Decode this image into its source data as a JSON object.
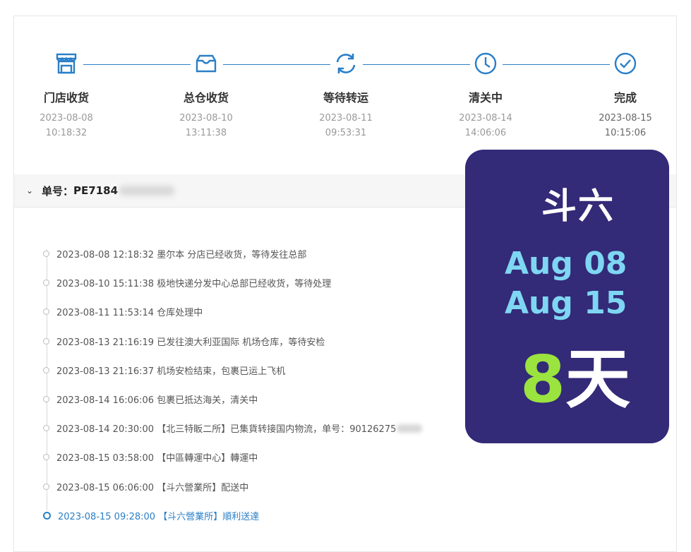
{
  "stepper": {
    "steps": [
      {
        "name": "门店收货",
        "date": "2023-08-08",
        "time": "10:18:32",
        "icon": "storefront-icon"
      },
      {
        "name": "总仓收货",
        "date": "2023-08-10",
        "time": "13:11:38",
        "icon": "warehouse-box-icon"
      },
      {
        "name": "等待转运",
        "date": "2023-08-11",
        "time": "09:53:31",
        "icon": "refresh-icon"
      },
      {
        "name": "清关中",
        "date": "2023-08-14",
        "time": "14:06:06",
        "icon": "clock-icon"
      },
      {
        "name": "完成",
        "date": "2023-08-15",
        "time": "10:15:06",
        "icon": "check-circle-icon"
      }
    ]
  },
  "order": {
    "label": "单号：",
    "number_visible": "PE7184"
  },
  "timeline": [
    {
      "text": "2023-08-08 12:18:32 墨尔本 分店已经收货，等待发往总部"
    },
    {
      "text": "2023-08-10 15:11:38 极地快递分发中心总部已经收货，等待处理"
    },
    {
      "text": "2023-08-11 11:53:14 仓库处理中"
    },
    {
      "text": "2023-08-13 21:16:19 已发往澳大利亚国际 机场仓库，等待安检"
    },
    {
      "text": "2023-08-13 21:16:37 机场安检结束，包裹已运上飞机"
    },
    {
      "text": "2023-08-14 16:06:06 包裹已抵达海关，清关中"
    },
    {
      "text": "2023-08-14 20:30:00 【北三特眅二所】已集貨转接国内物流，单号：90126275"
    },
    {
      "text": "2023-08-15 03:58:00 【中區轉運中心】轉運中"
    },
    {
      "text": "2023-08-15 06:06:00 【斗六營業所】配送中"
    },
    {
      "text": "2023-08-15 09:28:00 【斗六營業所】順利送達"
    }
  ],
  "badge": {
    "city": "斗六",
    "start": "Aug 08",
    "end": "Aug 15",
    "days_number": "8",
    "days_unit": "天"
  },
  "colors": {
    "accent": "#2a7fc7",
    "badge_bg": "#332a78",
    "badge_date": "#7ed6f2",
    "badge_number": "#9be33f"
  }
}
